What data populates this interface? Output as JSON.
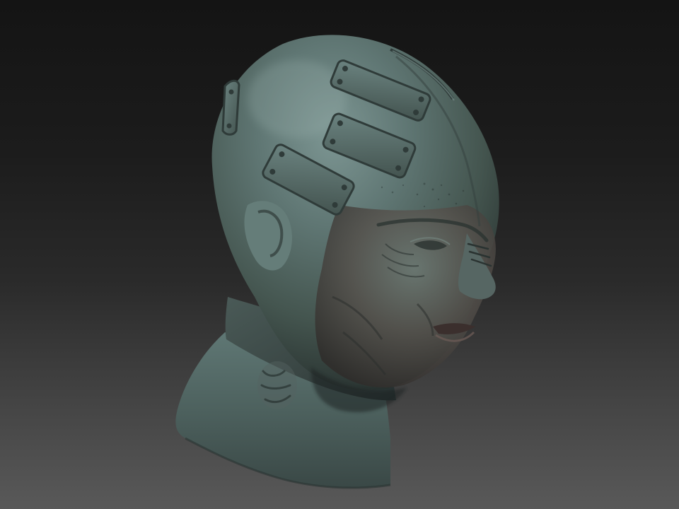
{
  "scene": {
    "subject": "sculpted-bust",
    "colors": {
      "background_top": "#141414",
      "background_bottom": "#595959",
      "skin_light": "#6f8784",
      "skin_mid": "#4f6361",
      "skin_dark": "#2c3735",
      "skin_warm": "#5e4a45",
      "plate": "#546966",
      "plate_edge": "#2f3b39"
    },
    "plates": [
      {
        "name": "top-plate"
      },
      {
        "name": "middle-plate"
      },
      {
        "name": "left-plate"
      },
      {
        "name": "back-plate"
      }
    ]
  }
}
